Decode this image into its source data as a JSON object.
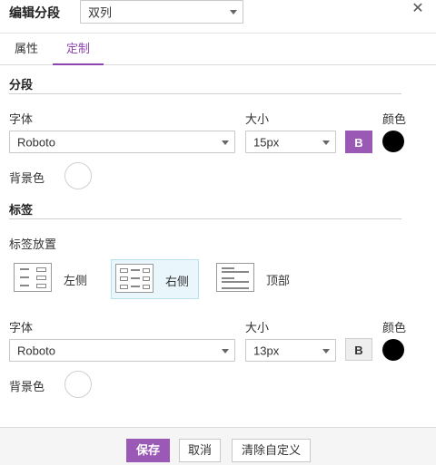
{
  "header": {
    "title": "编辑分段",
    "layout_select": "双列",
    "close_icon": "close-icon"
  },
  "tabs": [
    {
      "label": "属性",
      "active": false
    },
    {
      "label": "定制",
      "active": true
    }
  ],
  "accent_color": "#9b59b6",
  "segment": {
    "title": "分段",
    "font_label": "字体",
    "font_value": "Roboto",
    "size_label": "大小",
    "size_value": "15px",
    "bold_label": "B",
    "bold_active": true,
    "color_label": "颜色",
    "color_value": "#000000",
    "bg_label": "背景色",
    "bg_value": "#ffffff"
  },
  "tag": {
    "title": "标签",
    "placement_label": "标签放置",
    "placements": [
      {
        "label": "左侧",
        "icon": "label-left-icon",
        "selected": false
      },
      {
        "label": "右侧",
        "icon": "label-right-icon",
        "selected": true
      },
      {
        "label": "顶部",
        "icon": "label-top-icon",
        "selected": false
      }
    ],
    "font_label": "字体",
    "font_value": "Roboto",
    "size_label": "大小",
    "size_value": "13px",
    "bold_label": "B",
    "bold_active": false,
    "color_label": "颜色",
    "color_value": "#000000",
    "bg_label": "背景色",
    "bg_value": "#ffffff"
  },
  "footer": {
    "save": "保存",
    "cancel": "取消",
    "clear": "清除自定义"
  }
}
